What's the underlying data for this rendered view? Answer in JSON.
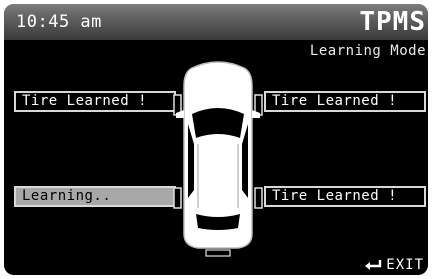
{
  "header": {
    "time": "10:45 am",
    "title": "TPMS",
    "subtitle": "Learning Mode"
  },
  "tires": {
    "front_left": "Tire Learned !",
    "front_right": "Tire Learned !",
    "rear_left": "Learning..",
    "rear_right": "Tire Learned !"
  },
  "footer": {
    "exit_label": "EXIT",
    "exit_icon": "enter-return-icon"
  },
  "colors": {
    "background": "#000000",
    "header_gradient_top": "#7d7d7d",
    "learning_highlight": "#a8a8a8",
    "text": "#ffffff"
  }
}
